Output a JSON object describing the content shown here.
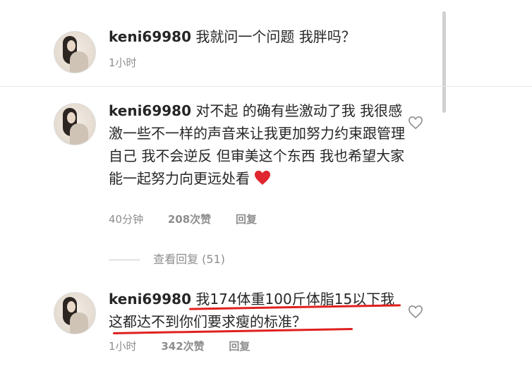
{
  "comments": [
    {
      "username": "keni69980",
      "text": "我就问一个问题 我胖吗？",
      "time": "1小时"
    },
    {
      "username": "keni69980",
      "text": "对不起 的确有些激动了我 我很感激一些不一样的声音来让我更加努力约束跟管理自己 我不会逆反 但审美这个东西 我也希望大家能一起努力向更远处看",
      "time": "40分钟",
      "likes": "208次赞",
      "reply_label": "回复",
      "view_replies": "查看回复 (51)"
    },
    {
      "username": "keni69980",
      "text": "我174体重100斤体脂15以下我这都达不到你们要求瘦的标准？",
      "time": "1小时",
      "likes": "342次赞",
      "reply_label": "回复"
    }
  ],
  "colors": {
    "text": "#262626",
    "meta": "#8e8e8e",
    "heart": "#e0262f",
    "underline": "#e02020"
  },
  "icons": [
    "heart-outline-icon",
    "red-heart-emoji"
  ]
}
